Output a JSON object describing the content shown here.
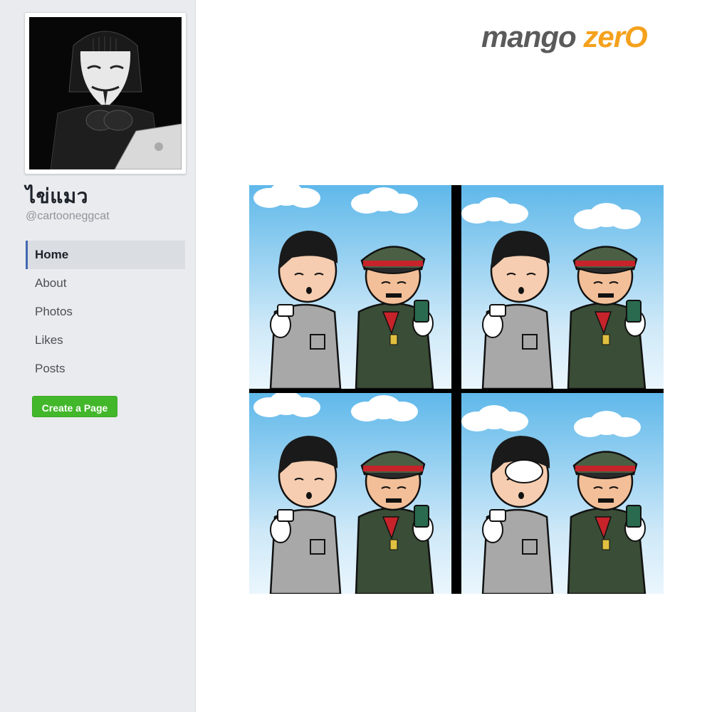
{
  "sidebar": {
    "page_name": "ไข่แมว",
    "handle": "@cartooneggcat",
    "nav": [
      {
        "label": "Home",
        "active": true
      },
      {
        "label": "About",
        "active": false
      },
      {
        "label": "Photos",
        "active": false
      },
      {
        "label": "Likes",
        "active": false
      },
      {
        "label": "Posts",
        "active": false
      }
    ],
    "create_page_label": "Create a Page"
  },
  "watermark": {
    "word1": "mango",
    "word2": "zerO"
  },
  "colors": {
    "sidebar_bg": "#e9ebee",
    "active_accent": "#4267b2",
    "create_button": "#42b72a",
    "logo_gray": "#5a5a5a",
    "logo_orange": "#f5a11c"
  }
}
